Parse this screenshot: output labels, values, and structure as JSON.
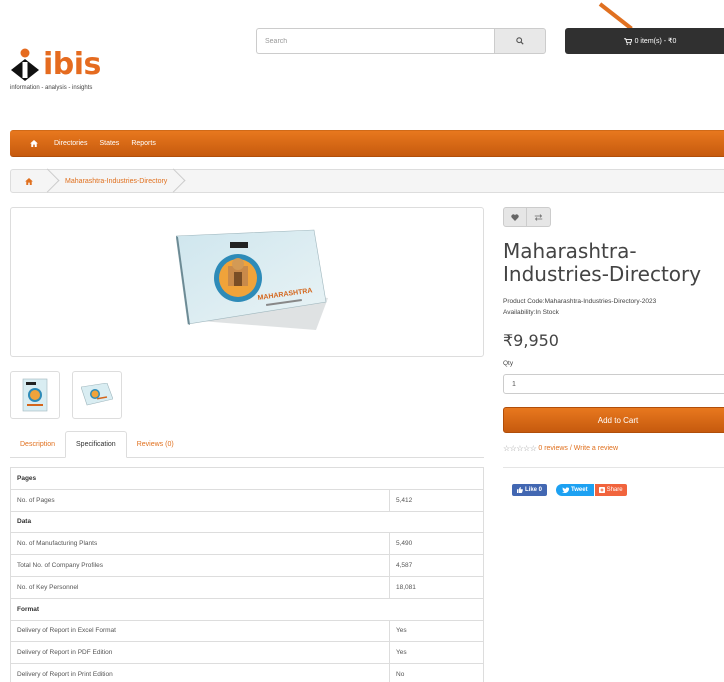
{
  "brand": {
    "name": "ibis",
    "tagline": "information - analysis - insights",
    "accent": "#e56b1f"
  },
  "search": {
    "placeholder": "Search",
    "icon": "search-icon"
  },
  "cart": {
    "label": "0 item(s) - ₹0",
    "icon": "cart-icon"
  },
  "nav": {
    "home_icon": "home-icon",
    "items": [
      {
        "label": "Directories"
      },
      {
        "label": "States"
      },
      {
        "label": "Reports"
      }
    ]
  },
  "breadcrumb": {
    "home_icon": "home-icon",
    "current": "Maharashtra-Industries-Directory"
  },
  "product": {
    "title": "Maharashtra-Industries-Directory",
    "code_label": "Product Code:",
    "code": "Maharashtra-Industries-Directory-2023",
    "availability_label": "Availability:",
    "availability": "In Stock",
    "price": "₹9,950",
    "qty_label": "Qty",
    "qty_value": "1",
    "add_to_cart": "Add to Cart",
    "rating_stars": 0,
    "reviews_link": "0 reviews",
    "rating_sep": " / ",
    "write_review": "Write a review",
    "book_cover_title": "MAHARASHTRA"
  },
  "tabs": [
    {
      "label": "Description",
      "active": false
    },
    {
      "label": "Specification",
      "active": true
    },
    {
      "label": "Reviews (0)",
      "active": false
    }
  ],
  "specs": {
    "pages_title": "Pages",
    "pages_label": "No. of Pages",
    "pages_value": "5,412",
    "data_title": "Data",
    "plants_label": "No. of Manufacturing Plants",
    "plants_value": "5,490",
    "profiles_label": "Total No. of Company Profiles",
    "profiles_value": "4,587",
    "personnel_label": "No. of Key Personnel",
    "personnel_value": "18,081",
    "format_title": "Format",
    "excel_label": "Delivery of Report in Excel Format",
    "excel_value": "Yes",
    "pdf_label": "Delivery of Report in PDF Edition",
    "pdf_value": "Yes",
    "print_label": "Delivery of Report in Print Edition",
    "print_value": "No"
  },
  "social": {
    "like": "Like 0",
    "tweet": "Tweet",
    "share": "Share"
  },
  "colors": {
    "nav_orange": "#e8781e",
    "dark": "#303030",
    "link": "#e0701e"
  }
}
